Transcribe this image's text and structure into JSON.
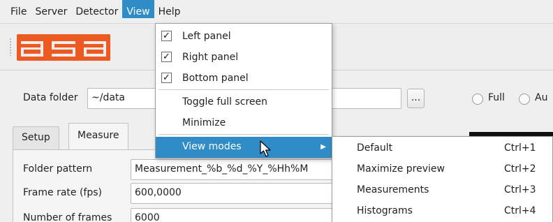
{
  "menubar": {
    "items": [
      "File",
      "Server",
      "Detector",
      "View",
      "Help"
    ]
  },
  "data_folder": {
    "label": "Data folder",
    "value": "~/data",
    "browse_label": "...",
    "radio_full": "Full",
    "radio_auto_partial": "Au"
  },
  "tabs": [
    "Setup",
    "Measure"
  ],
  "form": {
    "folder_pattern_label": "Folder pattern",
    "folder_pattern_value": "Measurement_%b_%d_%Y_%Hh%M",
    "frame_rate_label": "Frame rate (fps)",
    "frame_rate_value": "600,0000",
    "num_frames_label": "Number of frames",
    "num_frames_value": "6000"
  },
  "view_menu": {
    "items": [
      {
        "label": "Left panel",
        "checked": true
      },
      {
        "label": "Right panel",
        "checked": true
      },
      {
        "label": "Bottom panel",
        "checked": true
      },
      {
        "label": "Toggle full screen"
      },
      {
        "label": "Minimize"
      },
      {
        "label": "View modes",
        "submenu": true
      }
    ]
  },
  "view_modes": [
    {
      "label": "Default",
      "shortcut": "Ctrl+1"
    },
    {
      "label": "Maximize preview",
      "shortcut": "Ctrl+2"
    },
    {
      "label": "Measurements",
      "shortcut": "Ctrl+3"
    },
    {
      "label": "Histograms",
      "shortcut": "Ctrl+4"
    }
  ],
  "colors": {
    "highlight": "#308cc6",
    "logo": "#ec5a22"
  },
  "icons": {
    "check": "✓",
    "submenu_arrow": "▶"
  }
}
